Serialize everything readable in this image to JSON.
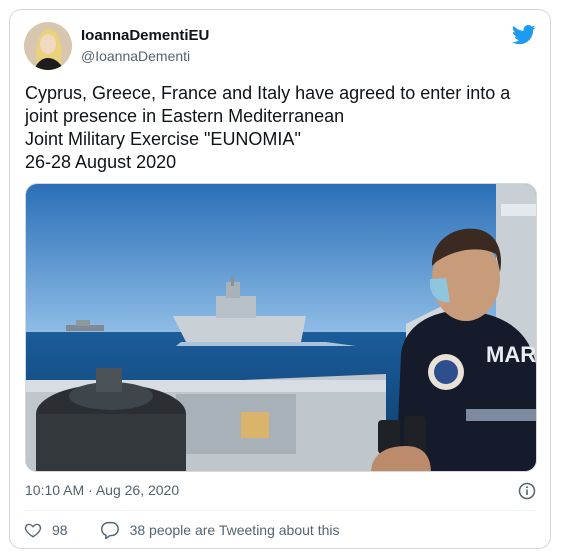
{
  "tweet": {
    "display_name": "IoannaDementiEU",
    "handle": "@IoannaDementi",
    "text_lines": [
      "Cyprus, Greece, France and Italy have agreed to enter into a",
      "joint presence in Eastern Mediterranean",
      "Joint Military Exercise \"EUNOMIA\"",
      "26-28 August 2020"
    ],
    "timestamp": "10:10 AM · Aug 26, 2020",
    "like_count": "98",
    "conversation_label": "38 people are Tweeting about this",
    "media_caption": "MARINE NA",
    "colors": {
      "twitter_blue": "#1d9bf0",
      "text_secondary": "#536471",
      "border": "#cfd9de"
    }
  },
  "icons": [
    "avatar",
    "twitter-bird-icon",
    "info-icon",
    "heart-icon",
    "comment-icon"
  ]
}
